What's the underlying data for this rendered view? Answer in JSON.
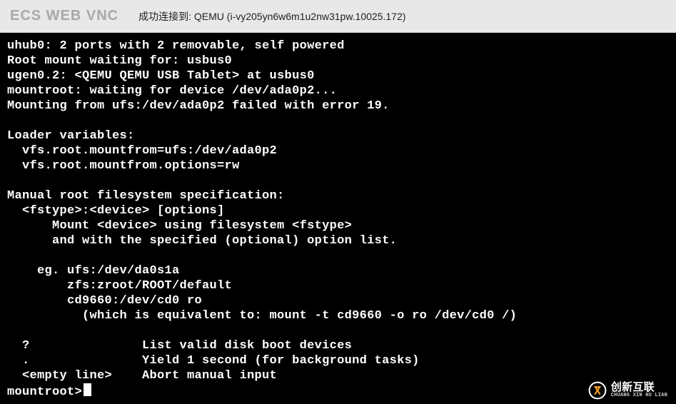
{
  "header": {
    "title": "ECS WEB VNC",
    "status": "成功连接到: QEMU (i-vy205yn6w6m1u2nw31pw.10025.172)"
  },
  "terminal": {
    "lines": [
      "uhub0: 2 ports with 2 removable, self powered",
      "Root mount waiting for: usbus0",
      "ugen0.2: <QEMU QEMU USB Tablet> at usbus0",
      "mountroot: waiting for device /dev/ada0p2...",
      "Mounting from ufs:/dev/ada0p2 failed with error 19.",
      "",
      "Loader variables:",
      "  vfs.root.mountfrom=ufs:/dev/ada0p2",
      "  vfs.root.mountfrom.options=rw",
      "",
      "Manual root filesystem specification:",
      "  <fstype>:<device> [options]",
      "      Mount <device> using filesystem <fstype>",
      "      and with the specified (optional) option list.",
      "",
      "    eg. ufs:/dev/da0s1a",
      "        zfs:zroot/ROOT/default",
      "        cd9660:/dev/cd0 ro",
      "          (which is equivalent to: mount -t cd9660 -o ro /dev/cd0 /)",
      "",
      "  ?               List valid disk boot devices",
      "  .               Yield 1 second (for background tasks)",
      "  <empty line>    Abort manual input",
      ""
    ],
    "prompt": "mountroot>"
  },
  "watermark": {
    "cn": "创新互联",
    "en": "CHUANG XIN HU LIAN"
  }
}
